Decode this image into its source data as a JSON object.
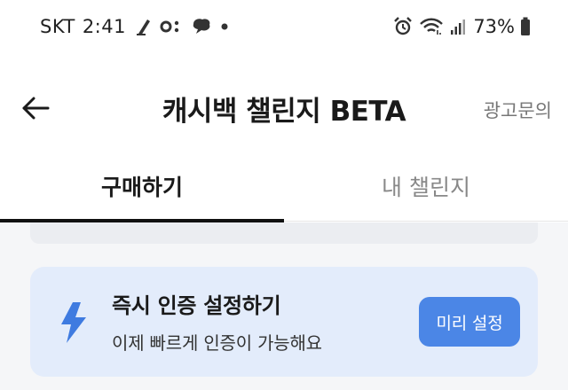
{
  "status_bar": {
    "carrier": "SKT",
    "time": "2:41",
    "battery_percent": "73%",
    "left_icons": [
      "pen-notification-icon",
      "link-notification-icon",
      "chat-bubble-notification-icon",
      "dot-notification-icon"
    ],
    "right_icons": [
      "alarm-icon",
      "wifi-icon",
      "signal-icon",
      "battery-icon"
    ]
  },
  "app_bar": {
    "title": "캐시백 챌린지 BETA",
    "ad_inquiry": "광고문의",
    "back_icon": "back-arrow-icon"
  },
  "tabs": [
    {
      "label": "구매하기",
      "selected": true
    },
    {
      "label": "내 챌린지",
      "selected": false
    }
  ],
  "promo_card": {
    "icon": "lightning-bolt-icon",
    "title": "즉시 인증 설정하기",
    "subtitle": "이제 빠르게 인증이 가능해요",
    "button_label": "미리 설정"
  },
  "colors": {
    "accent": "#4b86e6",
    "promo_background": "#e3ecfb",
    "content_background": "#f5f6f8"
  }
}
